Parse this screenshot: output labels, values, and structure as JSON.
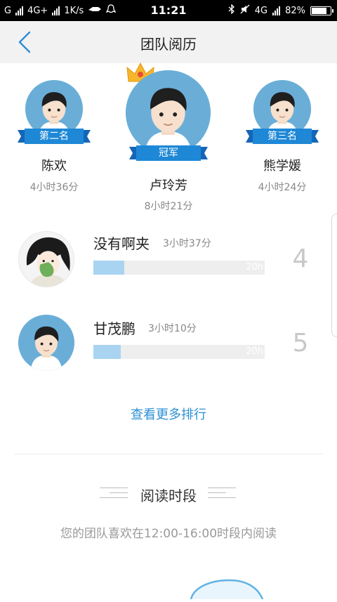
{
  "status_bar": {
    "carrier_left": "G",
    "network_1": "4G+",
    "speed": "1K/s",
    "time": "11:21",
    "network_2": "4G",
    "battery": "82%",
    "battery_level": 0.82
  },
  "nav": {
    "title": "团队阅历"
  },
  "podium": [
    {
      "badge": "冠军",
      "name": "卢玲芳",
      "time": "8小时21分"
    },
    {
      "badge": "第二名",
      "name": "陈欢",
      "time": "4小时36分"
    },
    {
      "badge": "第三名",
      "name": "熊学媛",
      "time": "4小时24分"
    }
  ],
  "ranking": [
    {
      "rank": "4",
      "name": "没有啊夹",
      "time": "3小时37分",
      "hours": 3.62,
      "max_label": "20h",
      "max_hours": 20
    },
    {
      "rank": "5",
      "name": "甘茂鹏",
      "time": "3小时10分",
      "hours": 3.17,
      "max_label": "20h",
      "max_hours": 20
    }
  ],
  "more_link": "查看更多排行",
  "reading_section": {
    "title": "阅读时段",
    "description": "您的团队喜欢在12:00-16:00时段内阅读"
  },
  "colors": {
    "accent": "#2c8fd4",
    "avatar_bg": "#6aaed8",
    "ribbon": "#1e88d6",
    "bar_fill": "#a8d4f1",
    "bar_track": "#eeeeee"
  }
}
